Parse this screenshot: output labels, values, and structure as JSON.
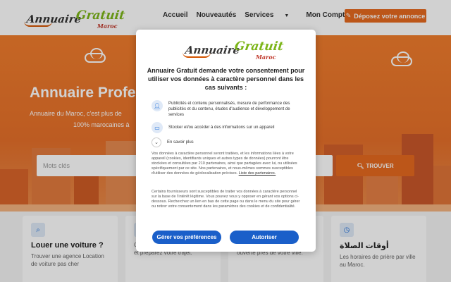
{
  "header": {
    "logo": {
      "word1": "Annuaire",
      "word2": "Gratuit",
      "word3": "Maroc"
    },
    "nav": [
      {
        "label": "Accueil"
      },
      {
        "label": "Nouveautés"
      },
      {
        "label": "Services"
      },
      {
        "label": "Mon Compte"
      }
    ],
    "cta_label": "Déposez votre annonce"
  },
  "hero": {
    "title": "Annuaire Profe",
    "subtitle_line1": "Annuaire du Maroc, c'est plus de",
    "subtitle_line2": "100% marocaines à",
    "search_placeholder": "Mots clés",
    "search_button": "TROUVER"
  },
  "cards": [
    {
      "title": "Louer une voiture ?",
      "text": "Trouver une agence Location de voiture pas cher"
    },
    {
      "title": "",
      "text": "Consultez les horaires de train et préparez votre trajet."
    },
    {
      "title": "",
      "text": "Trouvez une pharmacie ouverte près de votre ville."
    },
    {
      "title": "أوقات الصلاة",
      "text": "Les horaires de prière par ville au Maroc."
    }
  ],
  "consent": {
    "title": "Annuaire Gratuit demande votre consentement pour utiliser vos données à caractère personnel dans les cas suivants :",
    "purposes": [
      {
        "icon": "person-icon",
        "text": "Publicités et contenu personnalisés, mesure de performance des publicités et du contenu, études d'audience et développement de services"
      },
      {
        "icon": "device-icon",
        "text": "Stocker et/ou accéder à des informations sur un appareil"
      }
    ],
    "learn_more": "En savoir plus",
    "legal1": "Vos données à caractère personnel seront traitées, et les informations liées à votre appareil (cookies, identifiants uniques et autres types de données) pourront être stockées et consultées par 210 partenaires, ainsi que partagées avec lui, ou utilisées spécifiquement par ce site. Nos partenaires, et nous-mêmes sommes susceptibles d'utiliser des données de géolocalisation précises.",
    "legal1_link": "Liste des partenaires.",
    "legal2": "Certains fournisseurs sont susceptibles de traiter vos données à caractère personnel sur la base de l'intérêt légitime. Vous pouvez vous y opposer en gérant vos options ci-dessous. Recherchez un lien en bas de cette page ou dans le menu du site pour gérer ou retirer votre consentement dans les paramètres des cookies et de confidentialité.",
    "manage_button": "Gérer vos préférences",
    "accept_button": "Autoriser"
  },
  "colors": {
    "accent": "#e66a1f",
    "consent_blue": "#1a5fc9"
  }
}
